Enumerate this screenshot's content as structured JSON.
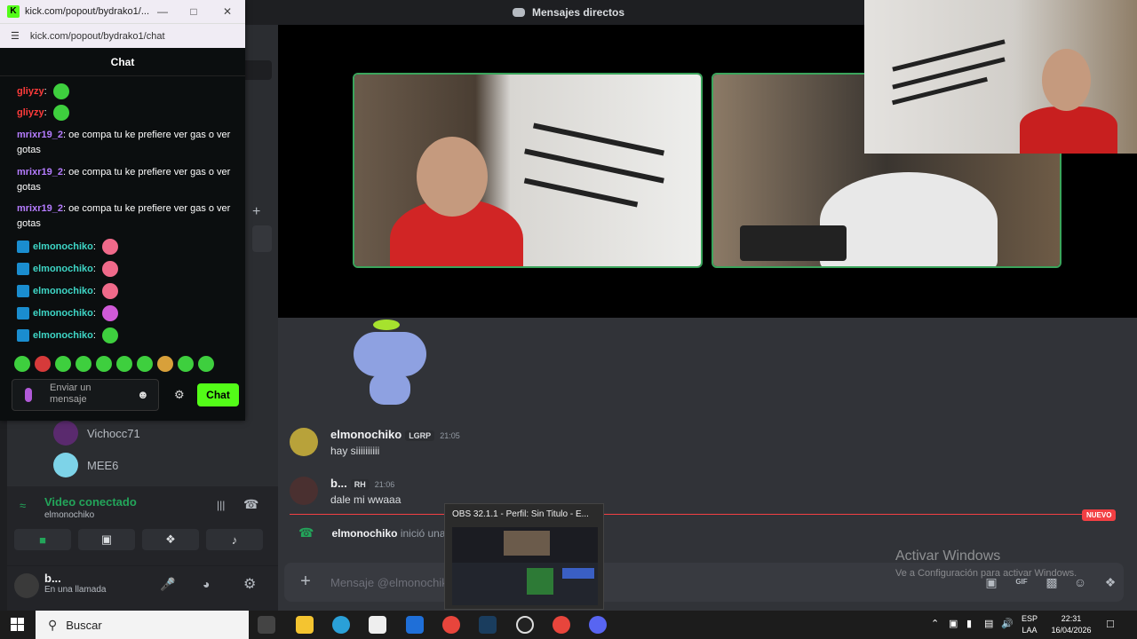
{
  "discord": {
    "window_title": "Mensajes directos",
    "dm_list": [
      {
        "name": "Vichocc71"
      },
      {
        "name": "MEE6"
      }
    ],
    "voice": {
      "status": "Video conectado",
      "channel": "elmonochiko"
    },
    "user": {
      "name": "b...",
      "status": "En una llamada"
    },
    "messages": [
      {
        "author": "elmonochiko",
        "tag": "LGRP",
        "time": "21:05",
        "text": "hay siiiiiiiiii"
      },
      {
        "author": "b...",
        "tag": "RH",
        "time": "21:06",
        "text": "dale mi wwaaa"
      }
    ],
    "new_badge": "NUEVO",
    "call_event": {
      "author": "elmonochiko",
      "text": "inició una"
    },
    "composer_placeholder": "Mensaje @elmonochiko",
    "watermark_title": "Activar Windows",
    "watermark_sub": "Ve a Configuración para activar Windows."
  },
  "obs_preview": {
    "title": "OBS 32.1.1 - Perfil: Sin Titulo - E..."
  },
  "kick": {
    "tab_title": "kick.com/popout/bydrako1/...",
    "url": "kick.com/popout/bydrako1/chat",
    "chat_header": "Chat",
    "messages": [
      {
        "user": "gliyzy",
        "text": "",
        "user_color": "#ff3b3b",
        "emote": true
      },
      {
        "user": "gliyzy",
        "text": "",
        "user_color": "#ff3b3b",
        "emote": true
      },
      {
        "user": "mrixr19_2",
        "text": "oe compa tu ke prefiere ver gas o ver gotas",
        "user_color": "#b57cff"
      },
      {
        "user": "mrixr19_2",
        "text": "oe compa tu ke prefiere ver gas o ver gotas",
        "user_color": "#b57cff"
      },
      {
        "user": "mrixr19_2",
        "text": "oe compa tu ke prefiere ver gas o ver gotas",
        "user_color": "#b57cff"
      },
      {
        "user": "elmonochiko",
        "text": "",
        "user_color": "#3ed6c6",
        "emote": true
      },
      {
        "user": "elmonochiko",
        "text": "",
        "user_color": "#3ed6c6",
        "emote": true
      },
      {
        "user": "elmonochiko",
        "text": "",
        "user_color": "#3ed6c6",
        "emote": true
      },
      {
        "user": "elmonochiko",
        "text": "",
        "user_color": "#3ed6c6",
        "emote": true
      },
      {
        "user": "elmonochiko",
        "text": "",
        "user_color": "#3ed6c6",
        "emote": true
      }
    ],
    "input_placeholder": "Enviar un mensaje",
    "send_label": "Chat",
    "accent": "#53fc18"
  },
  "taskbar": {
    "search_label": "Buscar",
    "lang1": "ESP",
    "lang2": "LAA",
    "time": "22:31",
    "date": "16/04/2026"
  }
}
